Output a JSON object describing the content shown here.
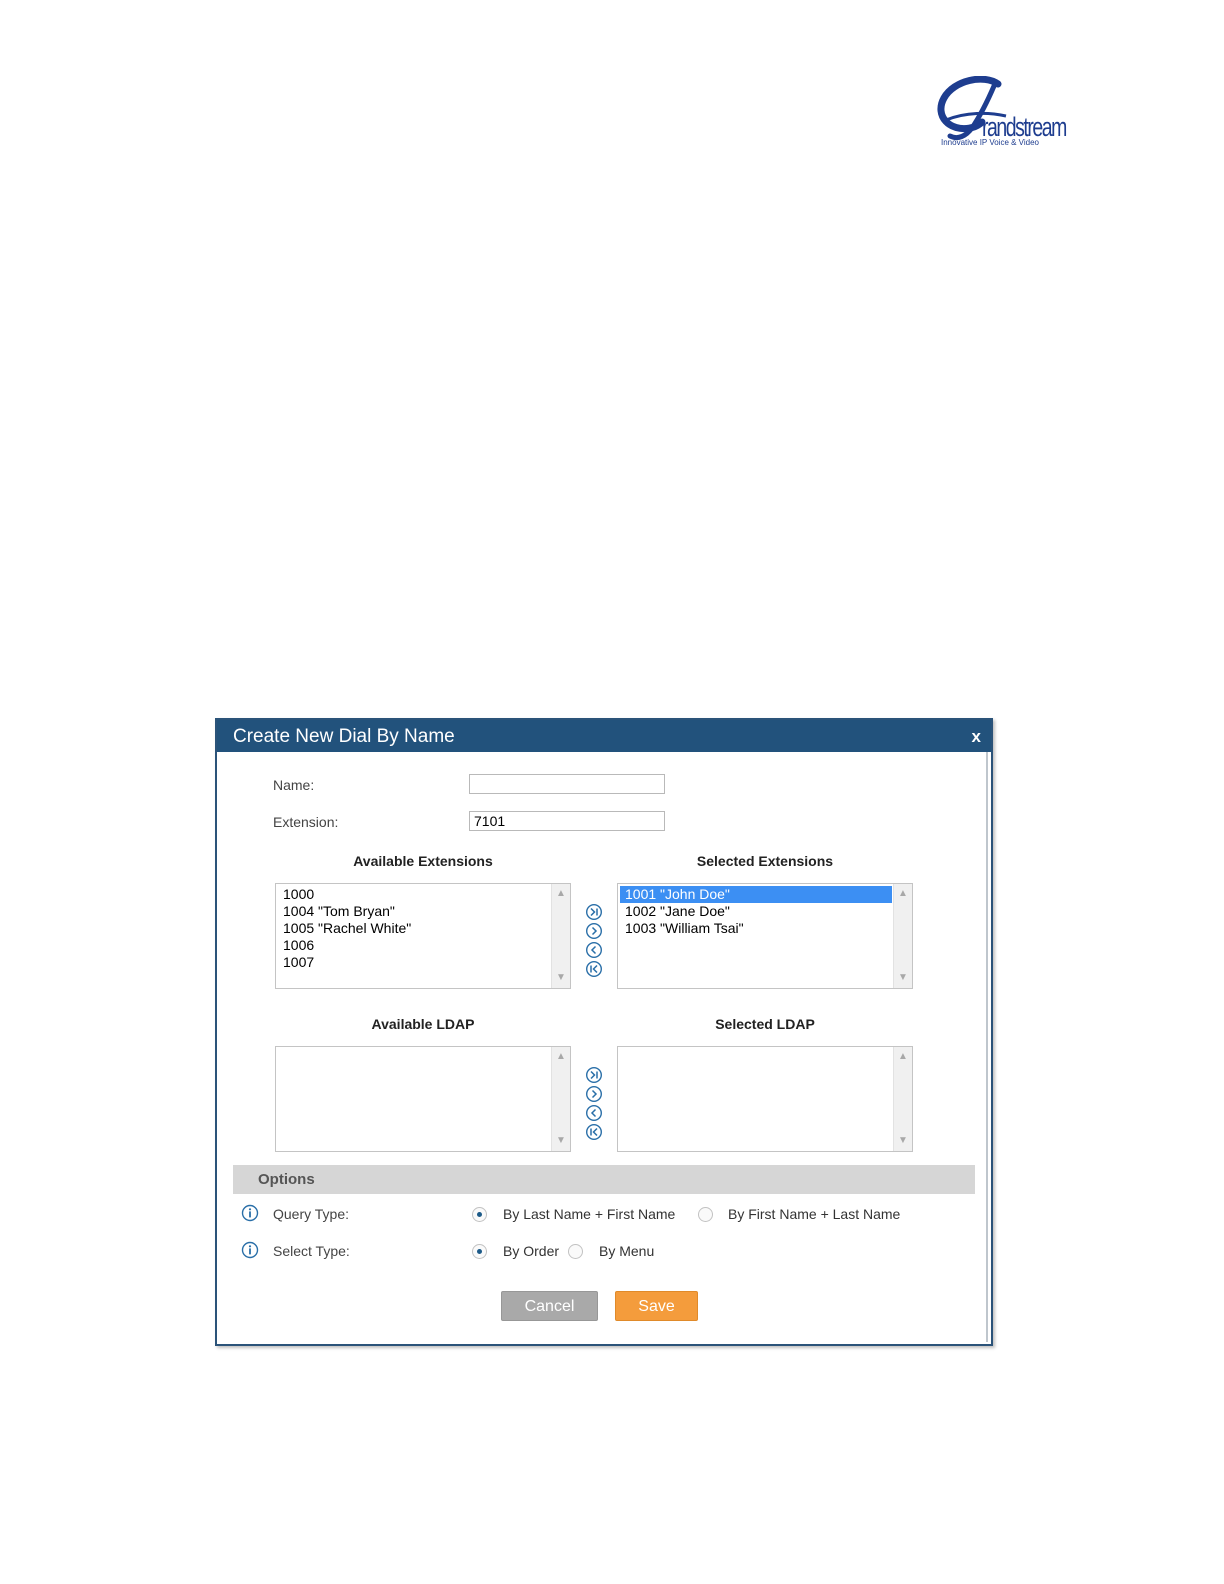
{
  "logo": {
    "word": "randstream",
    "tagline": "Innovative IP Voice & Video",
    "color": "#1e3d8f"
  },
  "dialog": {
    "title": "Create New Dial By Name",
    "close_label": "x",
    "titlebar_color": "#22527c",
    "name": {
      "label": "Name:",
      "value": ""
    },
    "extension": {
      "label": "Extension:",
      "value": "7101"
    },
    "available_extensions": {
      "heading": "Available Extensions",
      "items": [
        "1000",
        "1004 \"Tom Bryan\"",
        "1005 \"Rachel White\"",
        "1006",
        "1007"
      ]
    },
    "selected_extensions": {
      "heading": "Selected Extensions",
      "items": [
        "1001 \"John Doe\"",
        "1002 \"Jane Doe\"",
        "1003 \"William Tsai\""
      ],
      "selected_index": 0
    },
    "available_ldap": {
      "heading": "Available LDAP",
      "items": []
    },
    "selected_ldap": {
      "heading": "Selected LDAP",
      "items": []
    },
    "move_buttons": [
      "move-all-right-icon",
      "move-right-icon",
      "move-left-icon",
      "move-all-left-icon"
    ],
    "options": {
      "title": "Options",
      "query_type": {
        "label": "Query Type:",
        "options": [
          "By Last Name + First Name",
          "By First Name + Last Name"
        ],
        "selected": 0
      },
      "select_type": {
        "label": "Select Type:",
        "options": [
          "By Order",
          "By Menu"
        ],
        "selected": 0
      }
    },
    "buttons": {
      "cancel": "Cancel",
      "save": "Save"
    },
    "colors": {
      "save": "#f49c3c",
      "cancel": "#a9a9a9",
      "selection": "#3c8ff3"
    }
  }
}
